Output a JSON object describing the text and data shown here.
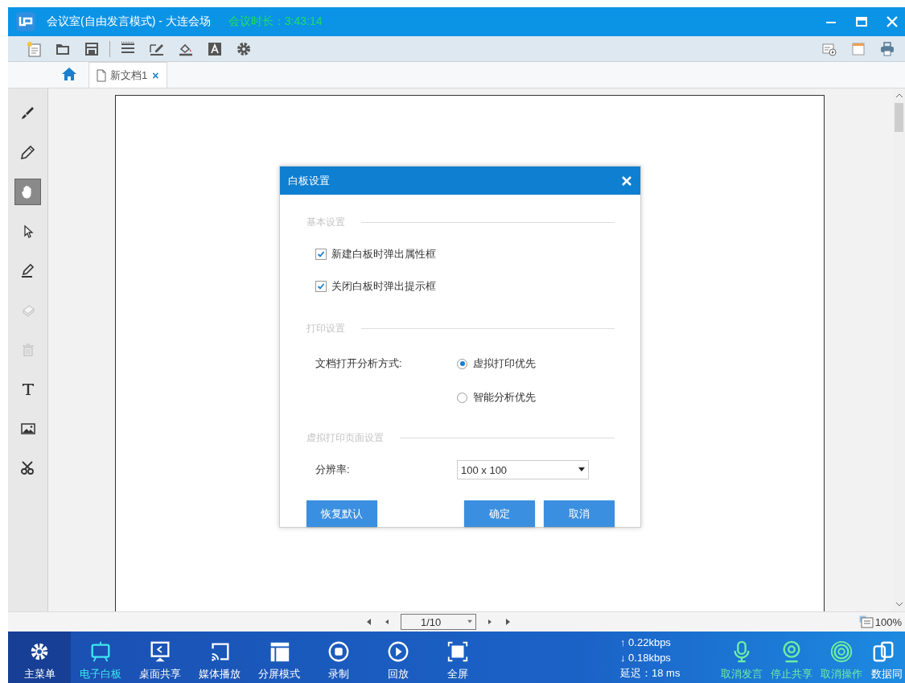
{
  "window": {
    "title": "会议室(自由发言模式) - 大连会场",
    "timer": "会议时长：3:43:14"
  },
  "tabs": [
    {
      "label": "新文档1",
      "selected": true,
      "close": "×"
    }
  ],
  "side_tools": [
    {
      "kind": "brush",
      "selected": false,
      "disabled": false
    },
    {
      "kind": "pencil",
      "selected": false,
      "disabled": false
    },
    {
      "kind": "hand",
      "selected": true,
      "disabled": false
    },
    {
      "kind": "pointer",
      "selected": false,
      "disabled": false
    },
    {
      "kind": "pen-line",
      "selected": false,
      "disabled": false
    },
    {
      "kind": "eraser",
      "selected": false,
      "disabled": true
    },
    {
      "kind": "trash",
      "selected": false,
      "disabled": true
    },
    {
      "kind": "text",
      "selected": false,
      "disabled": false
    },
    {
      "kind": "image",
      "selected": false,
      "disabled": false
    },
    {
      "kind": "scissors",
      "selected": false,
      "disabled": false
    }
  ],
  "dialog": {
    "title": "白板设置",
    "basic_section": "基本设置",
    "checkboxes": [
      {
        "label": "新建白板时弹出属性框",
        "checked": true
      },
      {
        "label": "关闭白板时弹出提示框",
        "checked": true
      }
    ],
    "print_section": "打印设置",
    "open_mode_label": "文档打开分析方式:",
    "radios": [
      {
        "label": "虚拟打印优先",
        "selected": true
      },
      {
        "label": "智能分析优先",
        "selected": false
      }
    ],
    "page_section": "虚拟打印页面设置",
    "resolution_label": "分辨率:",
    "resolution_value": "100 x 100",
    "buttons": [
      {
        "label": "恢复默认",
        "kind": "reset"
      },
      {
        "label": "确定",
        "kind": "ok"
      },
      {
        "label": "取消",
        "kind": "cancel"
      }
    ]
  },
  "pager": {
    "page": "1/10",
    "zoom": "100%"
  },
  "nav": [
    {
      "kind": "menu",
      "label": "主菜单",
      "selected": false
    },
    {
      "kind": "whiteboard",
      "label": "电子白板",
      "selected": true
    },
    {
      "kind": "desktop",
      "label": "桌面共享",
      "selected": false
    },
    {
      "kind": "cast",
      "label": "媒体播放",
      "selected": false
    },
    {
      "kind": "split",
      "label": "分屏模式",
      "selected": false
    },
    {
      "kind": "record",
      "label": "录制",
      "selected": false
    },
    {
      "kind": "playback",
      "label": "回放",
      "selected": false
    },
    {
      "kind": "fullscreen",
      "label": "全屏",
      "selected": false
    }
  ],
  "stats": {
    "upload": "↑ 0.22kbps",
    "download": "↓ 0.18kbps",
    "latency": "延迟：18 ms"
  },
  "actions": [
    {
      "kind": "mic",
      "label": "取消发言"
    },
    {
      "kind": "camera",
      "label": "停止共享"
    },
    {
      "kind": "target",
      "label": "取消操作"
    },
    {
      "kind": "sync",
      "label": "数据同"
    }
  ]
}
